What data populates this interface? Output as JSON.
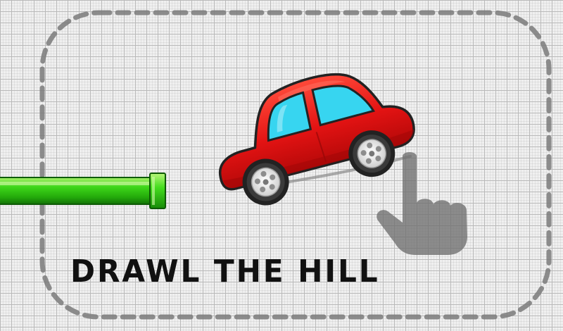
{
  "instruction": {
    "text": "DRAWL THE HILL"
  },
  "colors": {
    "car_body": "#e31313",
    "car_window": "#37d5f0",
    "pipe": "#33cc11",
    "dashed_border": "#7a7a7a",
    "hand_shadow": "#6e6e6e",
    "text": "#111111"
  },
  "icons": {
    "pointer": "pointing-hand-icon",
    "vehicle": "red-car"
  }
}
